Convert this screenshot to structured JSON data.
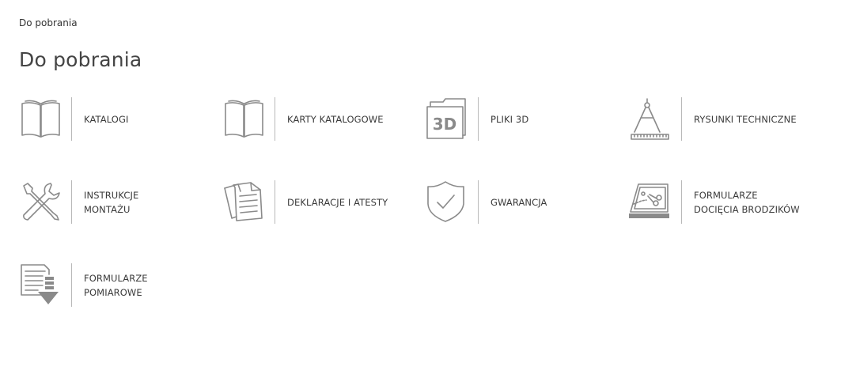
{
  "breadcrumb": "Do pobrania",
  "title": "Do pobrania",
  "items": [
    {
      "icon": "open-book-icon",
      "lines": [
        "KATALOGI"
      ]
    },
    {
      "icon": "open-book-icon",
      "lines": [
        "KARTY KATALOGOWE"
      ]
    },
    {
      "icon": "3d-folder-icon",
      "icon_text": "3D",
      "lines": [
        "PLIKI 3D"
      ]
    },
    {
      "icon": "drafting-compass-icon",
      "lines": [
        "RYSUNKI TECHNICZNE"
      ]
    },
    {
      "icon": "wrench-screwdriver-icon",
      "lines": [
        "INSTRUKCJE",
        "MONTAŻU"
      ]
    },
    {
      "icon": "documents-stack-icon",
      "lines": [
        "DEKLARACJE I ATESTY"
      ]
    },
    {
      "icon": "shield-check-icon",
      "lines": [
        "GWARANCJA"
      ]
    },
    {
      "icon": "scissors-tray-icon",
      "lines": [
        "FORMULARZE",
        "DOCIĘCIA BRODZIKÓW"
      ]
    },
    {
      "icon": "download-form-icon",
      "lines": [
        "FORMULARZE",
        "POMIAROWE"
      ]
    }
  ]
}
